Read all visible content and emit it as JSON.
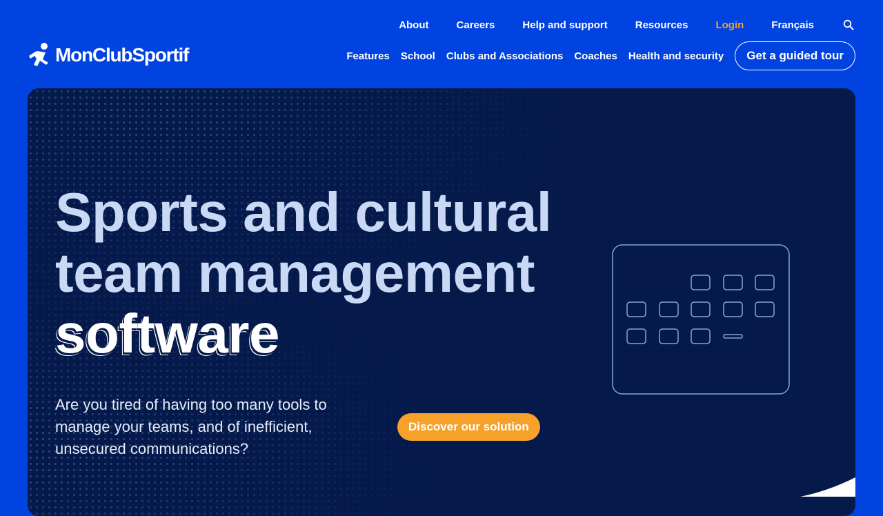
{
  "brand": {
    "name": "MonClubSportif",
    "colors": {
      "background": "#0143e0",
      "hero": "#051a4a",
      "accent": "#f5a12a",
      "text_light": "#c8d8f5"
    }
  },
  "top_nav": {
    "items": [
      {
        "label": "About"
      },
      {
        "label": "Careers"
      },
      {
        "label": "Help and support"
      },
      {
        "label": "Resources"
      },
      {
        "label": "Login"
      },
      {
        "label": "Français"
      }
    ],
    "search_icon": "search-icon"
  },
  "main_nav": {
    "items": [
      {
        "label": "Features"
      },
      {
        "label": "School"
      },
      {
        "label": "Clubs and Associations"
      },
      {
        "label": "Coaches"
      },
      {
        "label": "Health and security"
      }
    ],
    "tour_button": "Get a guided tour"
  },
  "hero": {
    "title_line1": "Sports and cultural",
    "title_line2": "team management",
    "title_line3": "software",
    "subtitle": "Are you tired of having too many tools to manage your teams, and of inefficient, unsecured communications?",
    "cta": "Discover our solution",
    "illustration_icon": "calendar-icon"
  }
}
